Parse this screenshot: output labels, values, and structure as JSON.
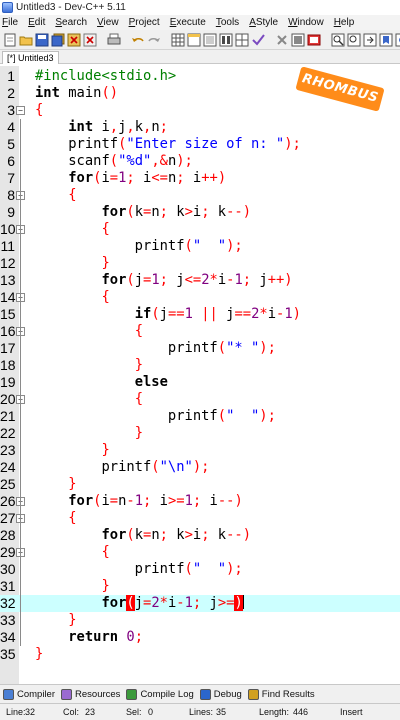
{
  "window": {
    "title": "Untitled3 - Dev-C++ 5.11"
  },
  "menu": [
    "File",
    "Edit",
    "Search",
    "View",
    "Project",
    "Execute",
    "Tools",
    "AStyle",
    "Window",
    "Help"
  ],
  "menu_underline": [
    "F",
    "E",
    "S",
    "V",
    "P",
    "E",
    "T",
    "A",
    "W",
    "H"
  ],
  "tab": {
    "label": "[*] Untitled3"
  },
  "badge": "RHOMBUS",
  "editor": {
    "current_line": 32,
    "lines": [
      [
        [
          "pp",
          "#include<stdio.h>"
        ]
      ],
      [
        [
          "kw",
          "int"
        ],
        [
          "plain",
          " main"
        ],
        [
          "sym",
          "()"
        ]
      ],
      [
        [
          "sym",
          "{"
        ]
      ],
      [
        [
          "plain",
          "    "
        ],
        [
          "kw",
          "int"
        ],
        [
          "plain",
          " i"
        ],
        [
          "sym",
          ","
        ],
        [
          "plain",
          "j"
        ],
        [
          "sym",
          ","
        ],
        [
          "plain",
          "k"
        ],
        [
          "sym",
          ","
        ],
        [
          "plain",
          "n"
        ],
        [
          "sym",
          ";"
        ]
      ],
      [
        [
          "plain",
          "    printf"
        ],
        [
          "sym",
          "("
        ],
        [
          "str",
          "\"Enter size of n: \""
        ],
        [
          "sym",
          ");"
        ]
      ],
      [
        [
          "plain",
          "    scanf"
        ],
        [
          "sym",
          "("
        ],
        [
          "str",
          "\"%d\""
        ],
        [
          "sym",
          ",&"
        ],
        [
          "plain",
          "n"
        ],
        [
          "sym",
          ");"
        ]
      ],
      [
        [
          "plain",
          "    "
        ],
        [
          "kw",
          "for"
        ],
        [
          "sym",
          "("
        ],
        [
          "plain",
          "i"
        ],
        [
          "sym",
          "="
        ],
        [
          "num",
          "1"
        ],
        [
          "sym",
          ";"
        ],
        [
          "plain",
          " i"
        ],
        [
          "sym",
          "<="
        ],
        [
          "plain",
          "n"
        ],
        [
          "sym",
          ";"
        ],
        [
          "plain",
          " i"
        ],
        [
          "sym",
          "++)"
        ]
      ],
      [
        [
          "plain",
          "    "
        ],
        [
          "sym",
          "{"
        ]
      ],
      [
        [
          "plain",
          "        "
        ],
        [
          "kw",
          "for"
        ],
        [
          "sym",
          "("
        ],
        [
          "plain",
          "k"
        ],
        [
          "sym",
          "="
        ],
        [
          "plain",
          "n"
        ],
        [
          "sym",
          ";"
        ],
        [
          "plain",
          " k"
        ],
        [
          "sym",
          ">"
        ],
        [
          "plain",
          "i"
        ],
        [
          "sym",
          ";"
        ],
        [
          "plain",
          " k"
        ],
        [
          "sym",
          "--)"
        ]
      ],
      [
        [
          "plain",
          "        "
        ],
        [
          "sym",
          "{"
        ]
      ],
      [
        [
          "plain",
          "            printf"
        ],
        [
          "sym",
          "("
        ],
        [
          "str",
          "\"  \""
        ],
        [
          "sym",
          ");"
        ]
      ],
      [
        [
          "plain",
          "        "
        ],
        [
          "sym",
          "}"
        ]
      ],
      [
        [
          "plain",
          "        "
        ],
        [
          "kw",
          "for"
        ],
        [
          "sym",
          "("
        ],
        [
          "plain",
          "j"
        ],
        [
          "sym",
          "="
        ],
        [
          "num",
          "1"
        ],
        [
          "sym",
          ";"
        ],
        [
          "plain",
          " j"
        ],
        [
          "sym",
          "<="
        ],
        [
          "num",
          "2"
        ],
        [
          "sym",
          "*"
        ],
        [
          "plain",
          "i"
        ],
        [
          "sym",
          "-"
        ],
        [
          "num",
          "1"
        ],
        [
          "sym",
          ";"
        ],
        [
          "plain",
          " j"
        ],
        [
          "sym",
          "++)"
        ]
      ],
      [
        [
          "plain",
          "        "
        ],
        [
          "sym",
          "{"
        ]
      ],
      [
        [
          "plain",
          "            "
        ],
        [
          "kw",
          "if"
        ],
        [
          "sym",
          "("
        ],
        [
          "plain",
          "j"
        ],
        [
          "sym",
          "=="
        ],
        [
          "num",
          "1"
        ],
        [
          "plain",
          " "
        ],
        [
          "sym",
          "||"
        ],
        [
          "plain",
          " j"
        ],
        [
          "sym",
          "=="
        ],
        [
          "num",
          "2"
        ],
        [
          "sym",
          "*"
        ],
        [
          "plain",
          "i"
        ],
        [
          "sym",
          "-"
        ],
        [
          "num",
          "1"
        ],
        [
          "sym",
          ")"
        ]
      ],
      [
        [
          "plain",
          "            "
        ],
        [
          "sym",
          "{"
        ]
      ],
      [
        [
          "plain",
          "                printf"
        ],
        [
          "sym",
          "("
        ],
        [
          "str",
          "\"* \""
        ],
        [
          "sym",
          ");"
        ]
      ],
      [
        [
          "plain",
          "            "
        ],
        [
          "sym",
          "}"
        ]
      ],
      [
        [
          "plain",
          "            "
        ],
        [
          "kw",
          "else"
        ]
      ],
      [
        [
          "plain",
          "            "
        ],
        [
          "sym",
          "{"
        ]
      ],
      [
        [
          "plain",
          "                printf"
        ],
        [
          "sym",
          "("
        ],
        [
          "str",
          "\"  \""
        ],
        [
          "sym",
          ");"
        ]
      ],
      [
        [
          "plain",
          "            "
        ],
        [
          "sym",
          "}"
        ]
      ],
      [
        [
          "plain",
          "        "
        ],
        [
          "sym",
          "}"
        ]
      ],
      [
        [
          "plain",
          "        printf"
        ],
        [
          "sym",
          "("
        ],
        [
          "str",
          "\"\\n\""
        ],
        [
          "sym",
          ");"
        ]
      ],
      [
        [
          "plain",
          "    "
        ],
        [
          "sym",
          "}"
        ]
      ],
      [
        [
          "plain",
          "    "
        ],
        [
          "kw",
          "for"
        ],
        [
          "sym",
          "("
        ],
        [
          "plain",
          "i"
        ],
        [
          "sym",
          "="
        ],
        [
          "plain",
          "n"
        ],
        [
          "sym",
          "-"
        ],
        [
          "num",
          "1"
        ],
        [
          "sym",
          ";"
        ],
        [
          "plain",
          " i"
        ],
        [
          "sym",
          ">="
        ],
        [
          "num",
          "1"
        ],
        [
          "sym",
          ";"
        ],
        [
          "plain",
          " i"
        ],
        [
          "sym",
          "--)"
        ]
      ],
      [
        [
          "plain",
          "    "
        ],
        [
          "sym",
          "{"
        ]
      ],
      [
        [
          "plain",
          "        "
        ],
        [
          "kw",
          "for"
        ],
        [
          "sym",
          "("
        ],
        [
          "plain",
          "k"
        ],
        [
          "sym",
          "="
        ],
        [
          "plain",
          "n"
        ],
        [
          "sym",
          ";"
        ],
        [
          "plain",
          " k"
        ],
        [
          "sym",
          ">"
        ],
        [
          "plain",
          "i"
        ],
        [
          "sym",
          ";"
        ],
        [
          "plain",
          " k"
        ],
        [
          "sym",
          "--)"
        ]
      ],
      [
        [
          "plain",
          "        "
        ],
        [
          "sym",
          "{"
        ]
      ],
      [
        [
          "plain",
          "            printf"
        ],
        [
          "sym",
          "("
        ],
        [
          "str",
          "\"  \""
        ],
        [
          "sym",
          ");"
        ]
      ],
      [
        [
          "plain",
          "        "
        ],
        [
          "sym",
          "}"
        ]
      ],
      [
        [
          "plain",
          "        "
        ],
        [
          "kw",
          "for"
        ],
        [
          "hlbr",
          "("
        ],
        [
          "plain",
          "j"
        ],
        [
          "sym",
          "="
        ],
        [
          "num",
          "2"
        ],
        [
          "sym",
          "*"
        ],
        [
          "plain",
          "i"
        ],
        [
          "sym",
          "-"
        ],
        [
          "num",
          "1"
        ],
        [
          "sym",
          ";"
        ],
        [
          "plain",
          " j"
        ],
        [
          "sym",
          ">="
        ],
        [
          "hlbr",
          ")"
        ]
      ],
      [
        [
          "plain",
          "    "
        ],
        [
          "sym",
          "}"
        ]
      ],
      [
        [
          "plain",
          "    "
        ],
        [
          "kw",
          "return"
        ],
        [
          "plain",
          " "
        ],
        [
          "num",
          "0"
        ],
        [
          "sym",
          ";"
        ]
      ],
      [
        [
          "sym",
          "}"
        ]
      ]
    ]
  },
  "bottom_tabs": [
    {
      "label": "Compiler",
      "icon": "compiler-icon"
    },
    {
      "label": "Resources",
      "icon": "resources-icon"
    },
    {
      "label": "Compile Log",
      "icon": "compile-log-icon"
    },
    {
      "label": "Debug",
      "icon": "debug-icon"
    },
    {
      "label": "Find Results",
      "icon": "find-results-icon"
    }
  ],
  "status": {
    "line_label": "Line:",
    "line": "32",
    "col_label": "Col:",
    "col": "23",
    "sel_label": "Sel:",
    "sel": "0",
    "lines_label": "Lines:",
    "lines": "35",
    "length_label": "Length:",
    "length": "446",
    "mode": "Insert"
  }
}
